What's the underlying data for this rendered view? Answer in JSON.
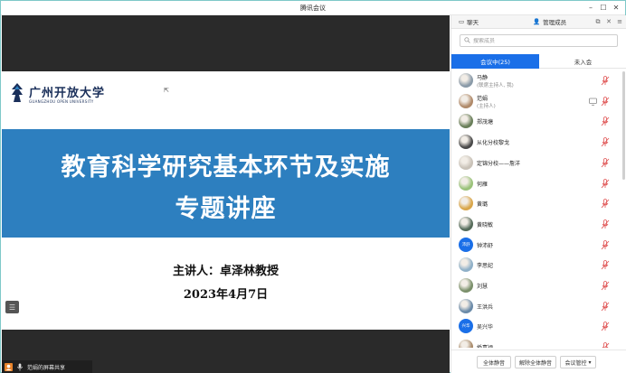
{
  "window": {
    "title": "腾讯会议"
  },
  "slide": {
    "logo_cn": "广州开放大学",
    "logo_en": "GUANGZHOU OPEN UNIVERSITY",
    "title_line1": "教育科学研究基本环节及实施",
    "title_line2": "专题讲座",
    "speaker": "主讲人：卓泽林教授",
    "date": "2023年4月7日"
  },
  "sharebar": {
    "text": "范娟的屏幕共享"
  },
  "panel": {
    "tab_chat": "聊天",
    "tab_members": "管理成员",
    "search_placeholder": "搜索成员",
    "seg_in": "会议中(25)",
    "seg_out": "未入会",
    "members": [
      {
        "name": "马静",
        "sub": "(联席主持人, 我)",
        "avatar": "photo",
        "color": "#8a9aa8"
      },
      {
        "name": "范娟",
        "sub": "(主持人)",
        "avatar": "photo",
        "color": "#b08a6a",
        "sharing": true
      },
      {
        "name": "郑茂塘",
        "avatar": "photo",
        "color": "#6a7f5a"
      },
      {
        "name": "从化分校黎戈",
        "avatar": "photo",
        "color": "#4a4a4a"
      },
      {
        "name": "定锦分校——詹洋",
        "avatar": "photo",
        "color": "#c9c2b8"
      },
      {
        "name": "何雁",
        "avatar": "photo",
        "color": "#9ac27a"
      },
      {
        "name": "黄璐",
        "avatar": "photo",
        "color": "#d9a64a"
      },
      {
        "name": "黄晓敏",
        "avatar": "photo",
        "color": "#556b5a"
      },
      {
        "name": "钟沛舒",
        "avatar": "text",
        "initials": "沛舒",
        "color": "#1a6fe8"
      },
      {
        "name": "李思妃",
        "avatar": "photo",
        "color": "#8fb0c8"
      },
      {
        "name": "刘慧",
        "avatar": "photo",
        "color": "#7a8f6a"
      },
      {
        "name": "王洪兵",
        "avatar": "photo",
        "color": "#6a8aa8"
      },
      {
        "name": "吴兴华",
        "avatar": "text",
        "initials": "兴华",
        "color": "#1a6fe8"
      },
      {
        "name": "侨嘉颖",
        "avatar": "photo",
        "color": "#a88a6a"
      }
    ],
    "btn_mute_all": "全体静音",
    "btn_unmute_all": "解除全体静音",
    "btn_manage": "会议管控"
  },
  "colors": {
    "accent": "#1a6fe8",
    "banner": "#2d7fbf",
    "mic_muted": "#e05555"
  }
}
